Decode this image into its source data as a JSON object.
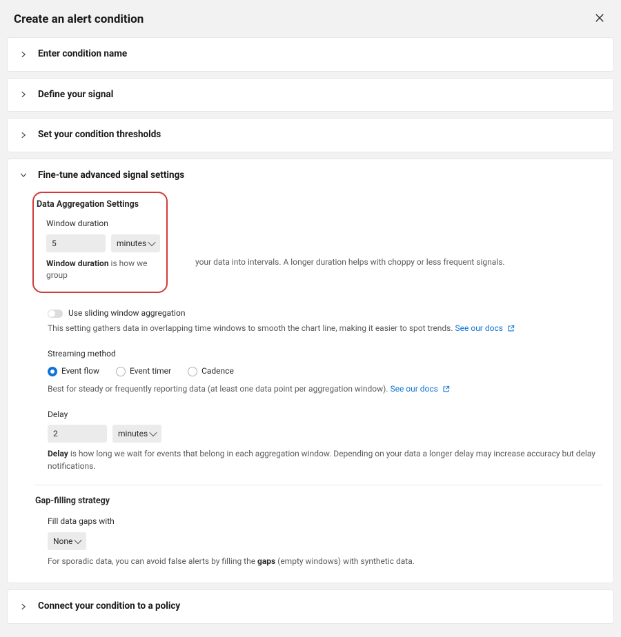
{
  "header": {
    "title": "Create an alert condition"
  },
  "sections": {
    "enter_name": {
      "title": "Enter condition name"
    },
    "define_signal": {
      "title": "Define your signal"
    },
    "thresholds": {
      "title": "Set your condition thresholds"
    },
    "finetune": {
      "title": "Fine-tune advanced signal settings",
      "data_agg_heading": "Data Aggregation Settings",
      "window_duration": {
        "label": "Window duration",
        "value": "5",
        "unit": "minutes",
        "help_bold": "Window duration",
        "help_rest_highlighted": " is how we group",
        "help_rest_outside": "your data into intervals. A longer duration helps with choppy or less frequent signals."
      },
      "sliding": {
        "label": "Use sliding window aggregation",
        "help": "This setting gathers data in overlapping time windows to smooth the chart line, making it easier to spot trends.",
        "docs_text": "See our docs"
      },
      "streaming": {
        "label": "Streaming method",
        "options": [
          "Event flow",
          "Event timer",
          "Cadence"
        ],
        "selected": 0,
        "help": "Best for steady or frequently reporting data (at least one data point per aggregation window).",
        "docs_text": "See our docs"
      },
      "delay": {
        "label": "Delay",
        "value": "2",
        "unit": "minutes",
        "help_bold": "Delay",
        "help_rest": " is how long we wait for events that belong in each aggregation window. Depending on your data a longer delay may increase accuracy but delay notifications."
      },
      "gap": {
        "heading": "Gap-filling strategy",
        "label": "Fill data gaps with",
        "value": "None",
        "help_pre": "For sporadic data, you can avoid false alerts by filling the ",
        "help_bold": "gaps",
        "help_post": " (empty windows) with synthetic data."
      }
    },
    "connect_policy": {
      "title": "Connect your condition to a policy"
    }
  }
}
